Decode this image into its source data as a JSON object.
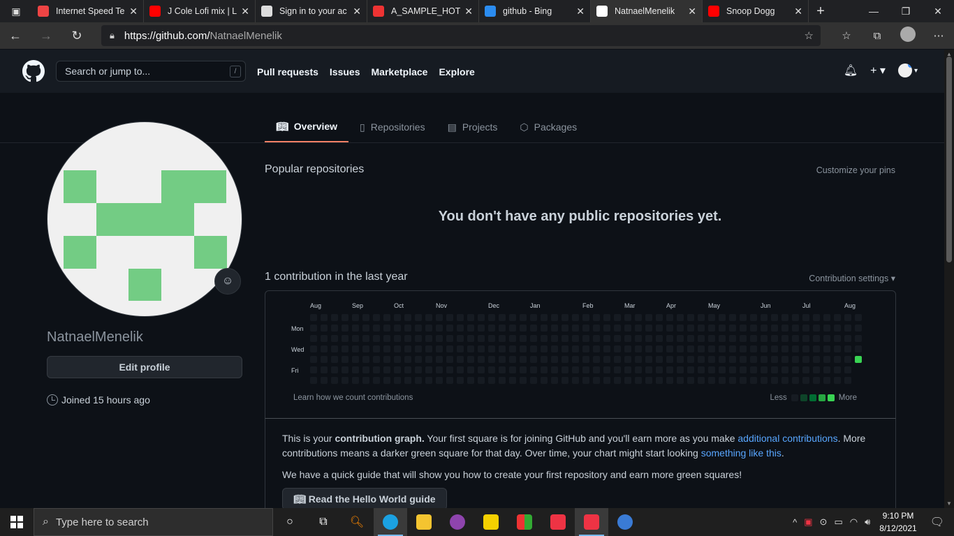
{
  "browser": {
    "tabs": [
      {
        "title": "Internet Speed Te",
        "favicon": "speedtest-icon",
        "color": "#e44"
      },
      {
        "title": "J Cole Lofi mix | L",
        "favicon": "youtube-icon",
        "color": "#f00"
      },
      {
        "title": "Sign in to your ac",
        "favicon": "page-icon",
        "color": "#ddd"
      },
      {
        "title": "A_SAMPLE_HOTE",
        "favicon": "pdf-icon",
        "color": "#e33"
      },
      {
        "title": "github - Bing",
        "favicon": "bing-icon",
        "color": "#2b8cf0"
      },
      {
        "title": "NatnaelMenelik",
        "favicon": "github-icon",
        "color": "#fff"
      },
      {
        "title": "Snoop Dogg",
        "favicon": "youtube-icon",
        "color": "#f00"
      }
    ],
    "url_host": "https://github.com/",
    "url_path": "NatnaelMenelik"
  },
  "gh": {
    "search_placeholder": "Search or jump to...",
    "slash": "/",
    "nav": [
      "Pull requests",
      "Issues",
      "Marketplace",
      "Explore"
    ]
  },
  "profile": {
    "tabs": [
      {
        "label": "Overview",
        "icon": "book-icon"
      },
      {
        "label": "Repositories",
        "icon": "repo-icon"
      },
      {
        "label": "Projects",
        "icon": "project-icon"
      },
      {
        "label": "Packages",
        "icon": "package-icon"
      }
    ],
    "username": "NatnaelMenelik",
    "edit_label": "Edit profile",
    "joined": "Joined 15 hours ago"
  },
  "main": {
    "popular_title": "Popular repositories",
    "customize": "Customize your pins",
    "no_repos": "You don't have any public repositories yet.",
    "contrib_title": "1 contribution in the last year",
    "contrib_settings": "Contribution settings ▾",
    "months": [
      "Aug",
      "Sep",
      "Oct",
      "Nov",
      "Dec",
      "Jan",
      "Feb",
      "Mar",
      "Apr",
      "May",
      "Jun",
      "Jul",
      "Aug"
    ],
    "days": [
      "Mon",
      "Wed",
      "Fri"
    ],
    "learn": "Learn how we count contributions",
    "less": "Less",
    "more": "More",
    "level_colors": [
      "#161b22",
      "#0e4429",
      "#006d32",
      "#26a641",
      "#39d353"
    ],
    "info_p1_a": "This is your ",
    "info_p1_b": "contribution graph.",
    "info_p1_c": " Your first square is for joining GitHub and you'll earn more as you make ",
    "info_p1_link1": "additional contributions",
    "info_p1_d": ". More contributions means a darker green square for that day. Over time, your chart might start looking ",
    "info_p1_link2": "something like this",
    "info_p1_e": ".",
    "info_p2": "We have a quick guide that will show you how to create your first repository and earn more green squares!",
    "guide_label": "Read the Hello World guide"
  },
  "taskbar": {
    "search_placeholder": "Type here to search",
    "time": "9:10 PM",
    "date": "8/12/2021"
  }
}
